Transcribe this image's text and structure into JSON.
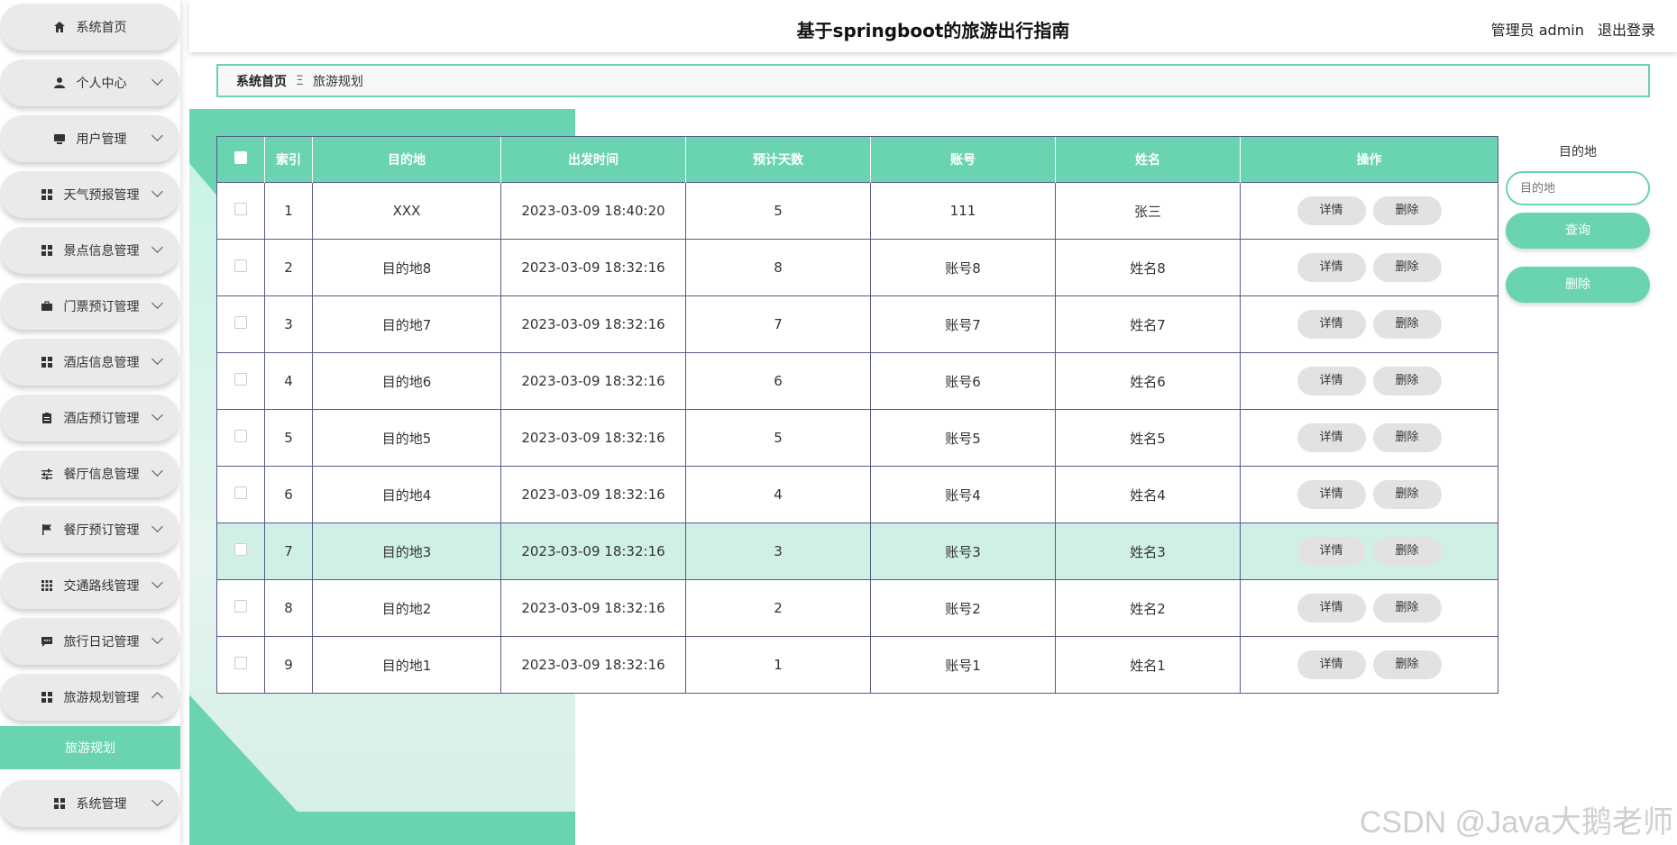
{
  "header": {
    "title": "基于springboot的旅游出行指南",
    "user_label": "管理员 admin",
    "logout_label": "退出登录"
  },
  "sidebar": {
    "items": [
      {
        "label": "系统首页",
        "icon": "home-icon",
        "has_chevron": false
      },
      {
        "label": "个人中心",
        "icon": "person-icon",
        "has_chevron": true
      },
      {
        "label": "用户管理",
        "icon": "monitor-icon",
        "has_chevron": true
      },
      {
        "label": "天气预报管理",
        "icon": "grid-icon",
        "has_chevron": true
      },
      {
        "label": "景点信息管理",
        "icon": "grid-icon",
        "has_chevron": true
      },
      {
        "label": "门票预订管理",
        "icon": "briefcase-icon",
        "has_chevron": true
      },
      {
        "label": "酒店信息管理",
        "icon": "grid-icon",
        "has_chevron": true
      },
      {
        "label": "酒店预订管理",
        "icon": "clipboard-icon",
        "has_chevron": true
      },
      {
        "label": "餐厅信息管理",
        "icon": "sliders-icon",
        "has_chevron": true
      },
      {
        "label": "餐厅预订管理",
        "icon": "flag-icon",
        "has_chevron": true
      },
      {
        "label": "交通路线管理",
        "icon": "apps-icon",
        "has_chevron": true
      },
      {
        "label": "旅行日记管理",
        "icon": "chat-icon",
        "has_chevron": true
      },
      {
        "label": "旅游规划管理",
        "icon": "grid-icon",
        "has_chevron": true,
        "expanded": true
      }
    ],
    "sub_item": "旅游规划",
    "last_item": {
      "label": "系统管理",
      "icon": "grid-icon",
      "has_chevron": true
    }
  },
  "breadcrumb": {
    "home": "系统首页",
    "separator": "Ξ",
    "current": "旅游规划"
  },
  "table": {
    "columns": [
      "索引",
      "目的地",
      "出发时间",
      "预计天数",
      "账号",
      "姓名",
      "操作"
    ],
    "rows": [
      [
        "1",
        "XXX",
        "2023-03-09 18:40:20",
        "5",
        "111",
        "张三"
      ],
      [
        "2",
        "目的地8",
        "2023-03-09 18:32:16",
        "8",
        "账号8",
        "姓名8"
      ],
      [
        "3",
        "目的地7",
        "2023-03-09 18:32:16",
        "7",
        "账号7",
        "姓名7"
      ],
      [
        "4",
        "目的地6",
        "2023-03-09 18:32:16",
        "6",
        "账号6",
        "姓名6"
      ],
      [
        "5",
        "目的地5",
        "2023-03-09 18:32:16",
        "5",
        "账号5",
        "姓名5"
      ],
      [
        "6",
        "目的地4",
        "2023-03-09 18:32:16",
        "4",
        "账号4",
        "姓名4"
      ],
      [
        "7",
        "目的地3",
        "2023-03-09 18:32:16",
        "3",
        "账号3",
        "姓名3"
      ],
      [
        "8",
        "目的地2",
        "2023-03-09 18:32:16",
        "2",
        "账号2",
        "姓名2"
      ],
      [
        "9",
        "目的地1",
        "2023-03-09 18:32:16",
        "1",
        "账号1",
        "姓名1"
      ]
    ],
    "highlighted_row": 7,
    "detail_label": "详情",
    "delete_label": "删除"
  },
  "search": {
    "label": "目的地",
    "placeholder": "目的地",
    "query_label": "查询",
    "delete_label": "删除"
  },
  "watermark": "CSDN @Java大鹅老师",
  "colors": {
    "accent": "#6ad3b1",
    "highlight_row": "#d0f0e6",
    "border": "#555a8a"
  }
}
